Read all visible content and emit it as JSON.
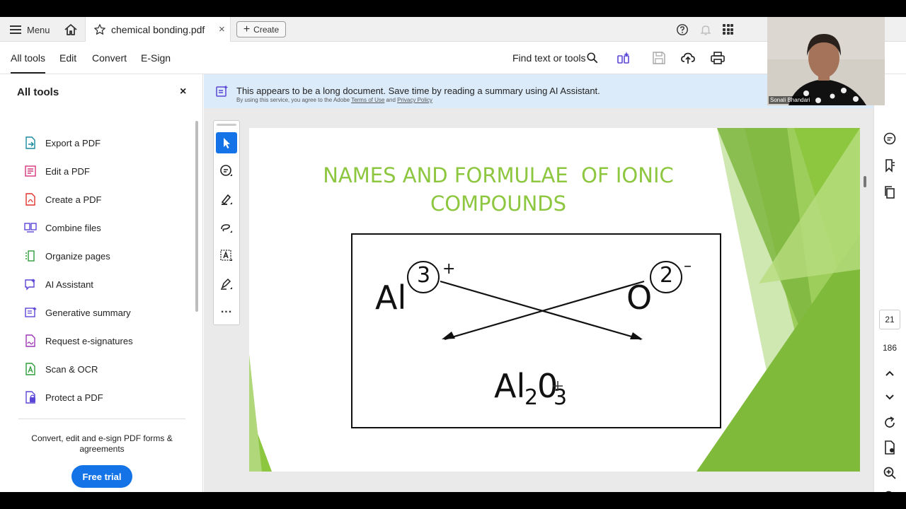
{
  "tabbar": {
    "menu_label": "Menu",
    "tab_title": "chemical bonding.pdf",
    "tab_close": "×",
    "create_label": "Create"
  },
  "toolbar": {
    "nav": [
      "All tools",
      "Edit",
      "Convert",
      "E-Sign"
    ],
    "find_label": "Find text or tools"
  },
  "left_panel": {
    "title": "All tools",
    "close": "×",
    "tools": [
      {
        "label": "Export a PDF",
        "icon": "export-pdf-icon",
        "color": "#1a8a9d"
      },
      {
        "label": "Edit a PDF",
        "icon": "edit-pdf-icon",
        "color": "#d6367c"
      },
      {
        "label": "Create a PDF",
        "icon": "create-pdf-icon",
        "color": "#e0332e"
      },
      {
        "label": "Combine files",
        "icon": "combine-files-icon",
        "color": "#5a46d6"
      },
      {
        "label": "Organize pages",
        "icon": "organize-pages-icon",
        "color": "#2d9d3a"
      },
      {
        "label": "AI Assistant",
        "icon": "ai-assistant-icon",
        "color": "#5a46d6"
      },
      {
        "label": "Generative summary",
        "icon": "generative-summary-icon",
        "color": "#5a46d6"
      },
      {
        "label": "Request e-signatures",
        "icon": "request-esignatures-icon",
        "color": "#9c36b5"
      },
      {
        "label": "Scan & OCR",
        "icon": "scan-ocr-icon",
        "color": "#2d9d3a"
      },
      {
        "label": "Protect a PDF",
        "icon": "protect-pdf-icon",
        "color": "#5a46d6"
      }
    ],
    "promo_text": "Convert, edit and e-sign PDF forms & agreements",
    "free_trial_label": "Free trial"
  },
  "banner": {
    "text": "This appears to be a long document. Save time by reading a summary using AI Assistant.",
    "sub_prefix": "By using this service, you agree to the Adobe",
    "terms_link": "Terms of Use",
    "sub_and": "and",
    "privacy_link": "Privacy Policy"
  },
  "toolstrip": {
    "more_label": "..."
  },
  "slide": {
    "title_line1": "NAMES AND FORMULAE  OF IONIC",
    "title_line2": "COMPOUNDS",
    "al_symbol": "Al",
    "al_charge_number": "3",
    "al_charge_sign": "+",
    "o_symbol": "O",
    "o_charge_number": "2",
    "o_charge_sign": "–",
    "product_al": "Al",
    "product_al_sub": "2",
    "product_o": "0",
    "product_o_sub": "3"
  },
  "right_rail": {
    "current_page": "21",
    "total_pages": "186"
  },
  "webcam": {
    "name": "Sonali Bhandari"
  },
  "colors": {
    "accent": "#1473e6",
    "slide_title": "#8dc63f",
    "banner_bg": "#dcebfa"
  }
}
